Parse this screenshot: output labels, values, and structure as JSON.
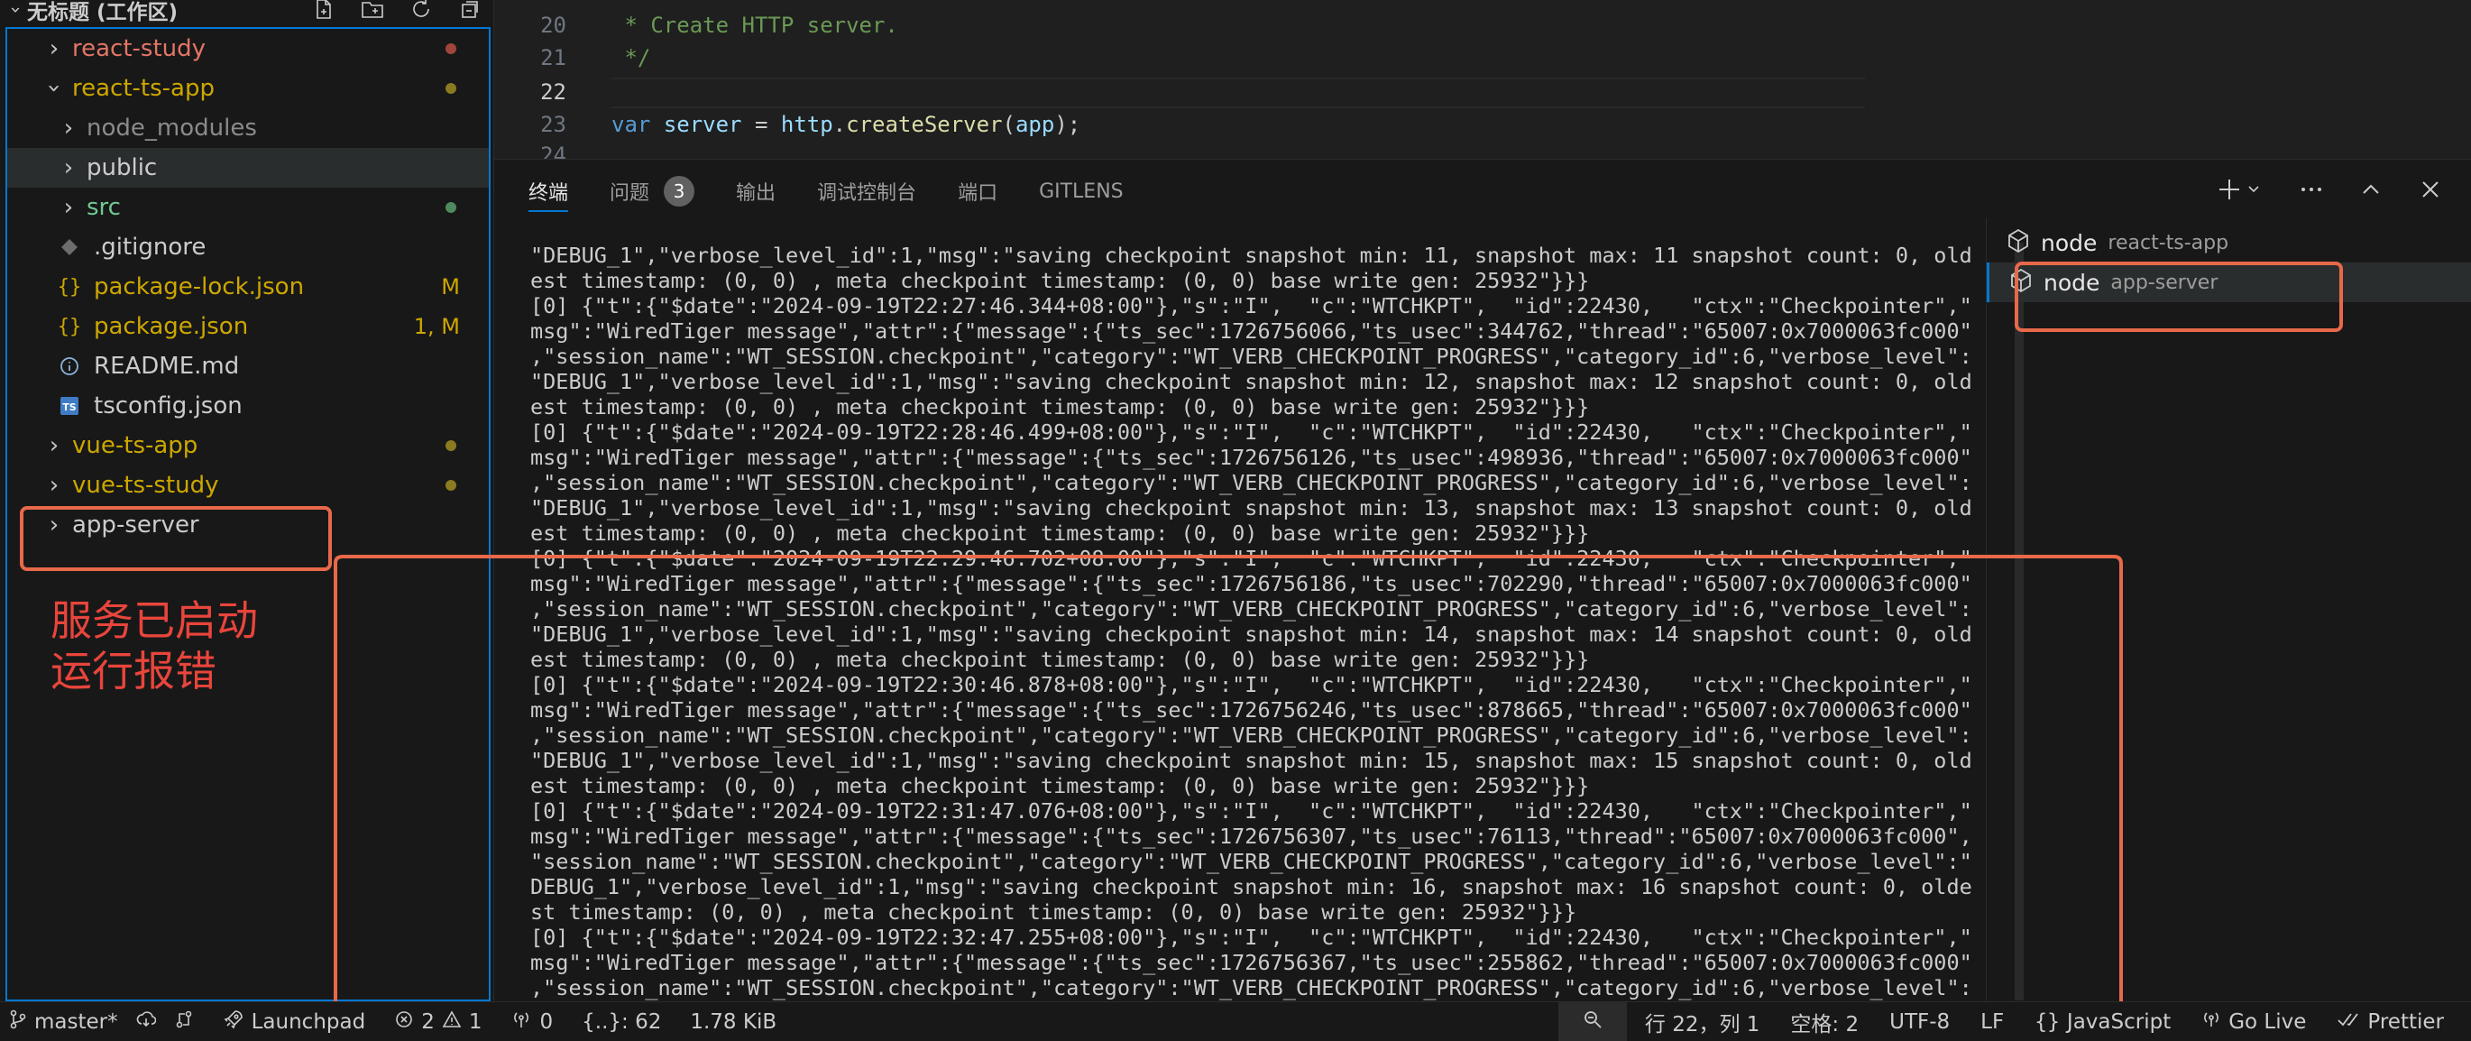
{
  "workspace": {
    "title": "无标题 (工作区)"
  },
  "explorer": {
    "items": [
      {
        "label": "react-study",
        "type": "folder",
        "open": false,
        "indent": 1,
        "color": "#e37566",
        "deco": "dot",
        "deco_color": "#a1453a"
      },
      {
        "label": "react-ts-app",
        "type": "folder",
        "open": true,
        "indent": 1,
        "color": "#cca700",
        "deco": "dot",
        "deco_color": "#8a7a20"
      },
      {
        "label": "node_modules",
        "type": "folder",
        "open": false,
        "indent": 2,
        "color": "#8b8b8b",
        "deco": "none"
      },
      {
        "label": "public",
        "type": "folder",
        "open": false,
        "indent": 2,
        "color": "#cccccc",
        "deco": "none",
        "selected": true
      },
      {
        "label": "src",
        "type": "folder",
        "open": false,
        "indent": 2,
        "color": "#73c991",
        "deco": "dot",
        "deco_color": "#4f8a5f"
      },
      {
        "label": ".gitignore",
        "type": "file",
        "icon": "gitignore-icon",
        "indent": 2,
        "color": "#cccccc",
        "deco": "none"
      },
      {
        "label": "package-lock.json",
        "type": "file",
        "icon": "json-icon",
        "indent": 2,
        "color": "#cca700",
        "deco": "badge",
        "badge": "M"
      },
      {
        "label": "package.json",
        "type": "file",
        "icon": "json-icon",
        "indent": 2,
        "color": "#cca700",
        "deco": "badge",
        "badge": "1, M"
      },
      {
        "label": "README.md",
        "type": "file",
        "icon": "info-icon",
        "indent": 2,
        "color": "#cccccc",
        "deco": "none"
      },
      {
        "label": "tsconfig.json",
        "type": "file",
        "icon": "ts-icon",
        "indent": 2,
        "color": "#cccccc",
        "deco": "none"
      },
      {
        "label": "vue-ts-app",
        "type": "folder",
        "open": false,
        "indent": 1,
        "color": "#cca700",
        "deco": "dot",
        "deco_color": "#8a7a20"
      },
      {
        "label": "vue-ts-study",
        "type": "folder",
        "open": false,
        "indent": 1,
        "color": "#cca700",
        "deco": "dot",
        "deco_color": "#8a7a20"
      },
      {
        "label": "app-server",
        "type": "folder",
        "open": false,
        "indent": 1,
        "color": "#cccccc",
        "deco": "none"
      }
    ]
  },
  "annotations": {
    "sidebar_note_line1": "服务已启动",
    "sidebar_note_line2": "运行报错",
    "color": "#e8694a"
  },
  "editor": {
    "lines": [
      {
        "num": "20",
        "text": " * Create HTTP server."
      },
      {
        "num": "21",
        "text": " */"
      },
      {
        "num": "22",
        "text": ""
      },
      {
        "num": "23",
        "text": "var server = http.createServer(app);"
      },
      {
        "num": "24",
        "text": ""
      }
    ],
    "active_line": "22"
  },
  "panel": {
    "tabs": [
      {
        "label": "终端",
        "active": true
      },
      {
        "label": "问题",
        "count": "3"
      },
      {
        "label": "输出"
      },
      {
        "label": "调试控制台"
      },
      {
        "label": "端口"
      },
      {
        "label": "GITLENS"
      }
    ],
    "terminals": [
      {
        "name": "node",
        "desc": "react-ts-app",
        "selected": false
      },
      {
        "name": "node",
        "desc": "app-server",
        "selected": true
      }
    ]
  },
  "terminal_lines": [
    "\"DEBUG_1\",\"verbose_level_id\":1,\"msg\":\"saving checkpoint snapshot min: 11, snapshot max: 11 snapshot count: 0, old",
    "est timestamp: (0, 0) , meta checkpoint timestamp: (0, 0) base write gen: 25932\"}}}",
    "[0] {\"t\":{\"$date\":\"2024-09-19T22:27:46.344+08:00\"},\"s\":\"I\",  \"c\":\"WTCHKPT\",  \"id\":22430,   \"ctx\":\"Checkpointer\",\"",
    "msg\":\"WiredTiger message\",\"attr\":{\"message\":{\"ts_sec\":1726756066,\"ts_usec\":344762,\"thread\":\"65007:0x7000063fc000\"",
    ",\"session_name\":\"WT_SESSION.checkpoint\",\"category\":\"WT_VERB_CHECKPOINT_PROGRESS\",\"category_id\":6,\"verbose_level\":",
    "\"DEBUG_1\",\"verbose_level_id\":1,\"msg\":\"saving checkpoint snapshot min: 12, snapshot max: 12 snapshot count: 0, old",
    "est timestamp: (0, 0) , meta checkpoint timestamp: (0, 0) base write gen: 25932\"}}}",
    "[0] {\"t\":{\"$date\":\"2024-09-19T22:28:46.499+08:00\"},\"s\":\"I\",  \"c\":\"WTCHKPT\",  \"id\":22430,   \"ctx\":\"Checkpointer\",\"",
    "msg\":\"WiredTiger message\",\"attr\":{\"message\":{\"ts_sec\":1726756126,\"ts_usec\":498936,\"thread\":\"65007:0x7000063fc000\"",
    ",\"session_name\":\"WT_SESSION.checkpoint\",\"category\":\"WT_VERB_CHECKPOINT_PROGRESS\",\"category_id\":6,\"verbose_level\":",
    "\"DEBUG_1\",\"verbose_level_id\":1,\"msg\":\"saving checkpoint snapshot min: 13, snapshot max: 13 snapshot count: 0, old",
    "est timestamp: (0, 0) , meta checkpoint timestamp: (0, 0) base write gen: 25932\"}}}",
    "[0] {\"t\":{\"$date\":\"2024-09-19T22:29:46.702+08:00\"},\"s\":\"I\",  \"c\":\"WTCHKPT\",  \"id\":22430,   \"ctx\":\"Checkpointer\",\"",
    "msg\":\"WiredTiger message\",\"attr\":{\"message\":{\"ts_sec\":1726756186,\"ts_usec\":702290,\"thread\":\"65007:0x7000063fc000\"",
    ",\"session_name\":\"WT_SESSION.checkpoint\",\"category\":\"WT_VERB_CHECKPOINT_PROGRESS\",\"category_id\":6,\"verbose_level\":",
    "\"DEBUG_1\",\"verbose_level_id\":1,\"msg\":\"saving checkpoint snapshot min: 14, snapshot max: 14 snapshot count: 0, old",
    "est timestamp: (0, 0) , meta checkpoint timestamp: (0, 0) base write gen: 25932\"}}}",
    "[0] {\"t\":{\"$date\":\"2024-09-19T22:30:46.878+08:00\"},\"s\":\"I\",  \"c\":\"WTCHKPT\",  \"id\":22430,   \"ctx\":\"Checkpointer\",\"",
    "msg\":\"WiredTiger message\",\"attr\":{\"message\":{\"ts_sec\":1726756246,\"ts_usec\":878665,\"thread\":\"65007:0x7000063fc000\"",
    ",\"session_name\":\"WT_SESSION.checkpoint\",\"category\":\"WT_VERB_CHECKPOINT_PROGRESS\",\"category_id\":6,\"verbose_level\":",
    "\"DEBUG_1\",\"verbose_level_id\":1,\"msg\":\"saving checkpoint snapshot min: 15, snapshot max: 15 snapshot count: 0, old",
    "est timestamp: (0, 0) , meta checkpoint timestamp: (0, 0) base write gen: 25932\"}}}",
    "[0] {\"t\":{\"$date\":\"2024-09-19T22:31:47.076+08:00\"},\"s\":\"I\",  \"c\":\"WTCHKPT\",  \"id\":22430,   \"ctx\":\"Checkpointer\",\"",
    "msg\":\"WiredTiger message\",\"attr\":{\"message\":{\"ts_sec\":1726756307,\"ts_usec\":76113,\"thread\":\"65007:0x7000063fc000\",",
    "\"session_name\":\"WT_SESSION.checkpoint\",\"category\":\"WT_VERB_CHECKPOINT_PROGRESS\",\"category_id\":6,\"verbose_level\":\"",
    "DEBUG_1\",\"verbose_level_id\":1,\"msg\":\"saving checkpoint snapshot min: 16, snapshot max: 16 snapshot count: 0, olde",
    "st timestamp: (0, 0) , meta checkpoint timestamp: (0, 0) base write gen: 25932\"}}}",
    "[0] {\"t\":{\"$date\":\"2024-09-19T22:32:47.255+08:00\"},\"s\":\"I\",  \"c\":\"WTCHKPT\",  \"id\":22430,   \"ctx\":\"Checkpointer\",\"",
    "msg\":\"WiredTiger message\",\"attr\":{\"message\":{\"ts_sec\":1726756367,\"ts_usec\":255862,\"thread\":\"65007:0x7000063fc000\"",
    ",\"session_name\":\"WT_SESSION.checkpoint\",\"category\":\"WT_VERB_CHECKPOINT_PROGRESS\",\"category_id\":6,\"verbose_level\":"
  ],
  "statusbar": {
    "branch": "master*",
    "launchpad": "Launchpad",
    "errors": "2",
    "warnings": "1",
    "ports": "0",
    "braces": "{..}: 62",
    "filesize": "1.78 KiB",
    "position": "行 22，列 1",
    "spaces": "空格: 2",
    "encoding": "UTF-8",
    "eol": "LF",
    "language": "JavaScript",
    "golive": "Go Live",
    "prettier": "Prettier"
  }
}
